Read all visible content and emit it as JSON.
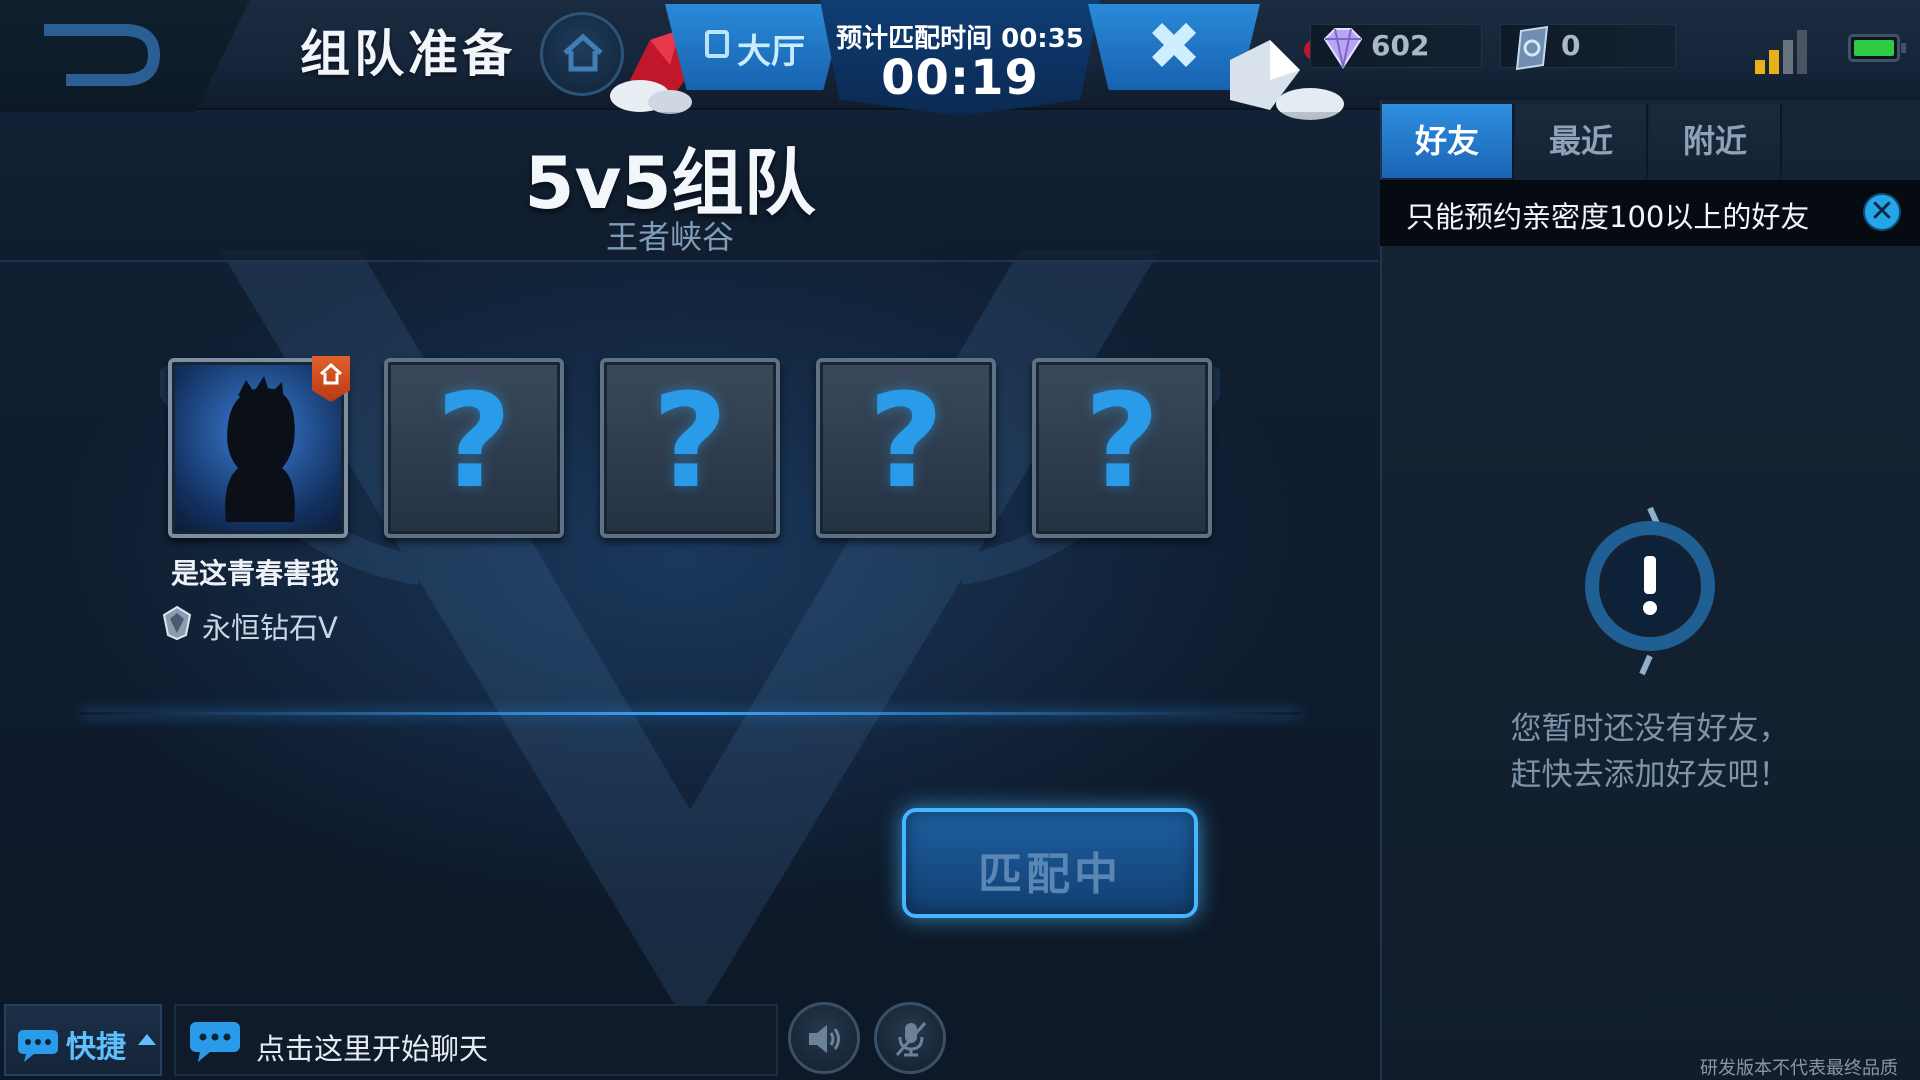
{
  "header": {
    "title": "组队准备",
    "lobby_label": "大厅",
    "estimated_time": "预计匹配时间 00:35",
    "elapsed_time": "00:19"
  },
  "currency": {
    "diamonds": "602",
    "coupons": "0"
  },
  "mode": {
    "title": "5v5组队",
    "map": "王者峡谷"
  },
  "team": {
    "player": {
      "name": "是这青春害我",
      "rank": "永恒钻石V"
    },
    "empty_slot_symbol": "?"
  },
  "match_button": "匹配中",
  "bottom": {
    "quick_label": "快捷",
    "chat_placeholder": "点击这里开始聊天"
  },
  "side_panel": {
    "tabs": [
      {
        "label": "好友",
        "active": true
      },
      {
        "label": "最近",
        "active": false
      },
      {
        "label": "附近",
        "active": false
      }
    ],
    "notice": "只能预约亲密度100以上的好友",
    "empty_line1": "您暂时还没有好友，",
    "empty_line2": "赶快去添加好友吧！"
  },
  "watermark": "研发版本不代表最终品质",
  "colors": {
    "accent_blue": "#2a8ad8",
    "question_blue": "#2a9be8",
    "signal_gold": "#e6b21a",
    "battery_green": "#2ecc40",
    "host_orange": "#e2602c"
  }
}
